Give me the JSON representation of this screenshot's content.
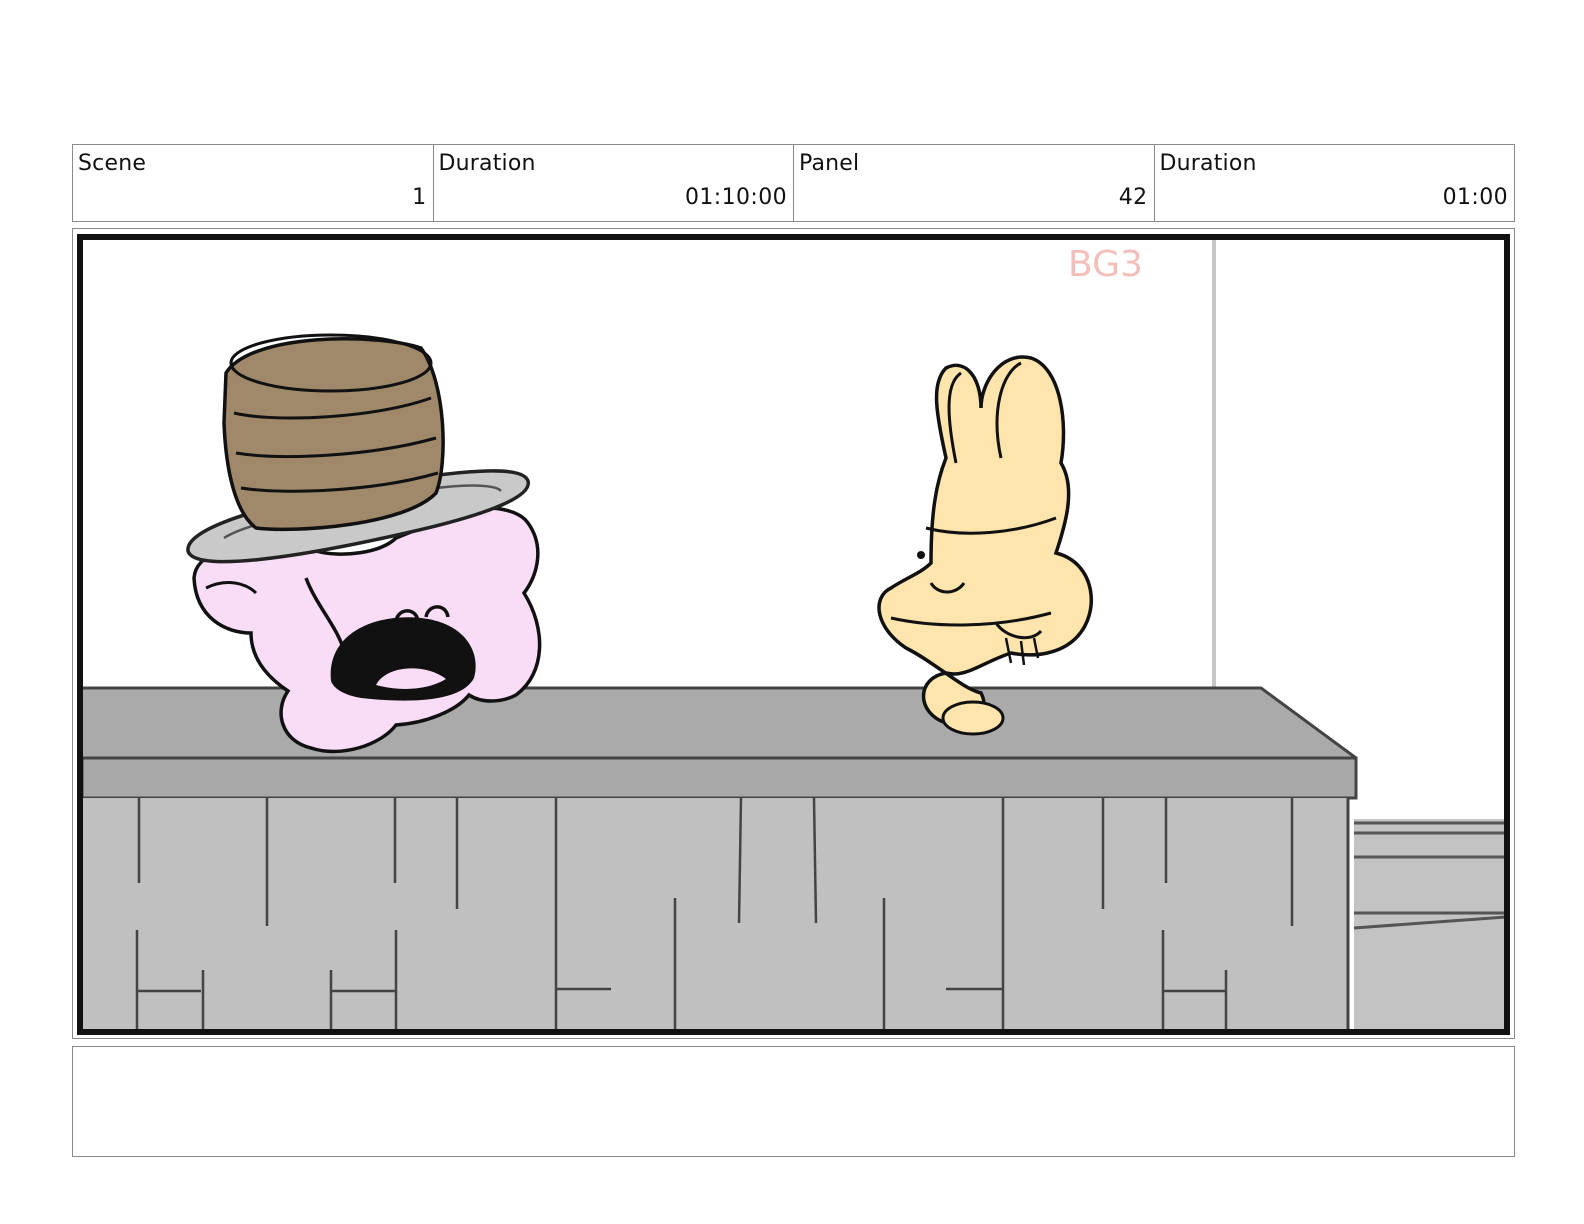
{
  "header": {
    "scene_label": "Scene",
    "scene_value": "1",
    "scene_duration_label": "Duration",
    "scene_duration_value": "01:10:00",
    "panel_label": "Panel",
    "panel_value": "42",
    "panel_duration_label": "Duration",
    "panel_duration_value": "01:00"
  },
  "panel": {
    "bg_tag": "BG3",
    "colors": {
      "counter": "#c0c0c0",
      "counter_top": "#aaaaaa",
      "pink_character": "#f9dcf6",
      "cake": "#a0896b",
      "yellow_character": "#fde5ad",
      "bg_tag_color": "#f2b9b3"
    }
  },
  "notes": {
    "text": ""
  }
}
